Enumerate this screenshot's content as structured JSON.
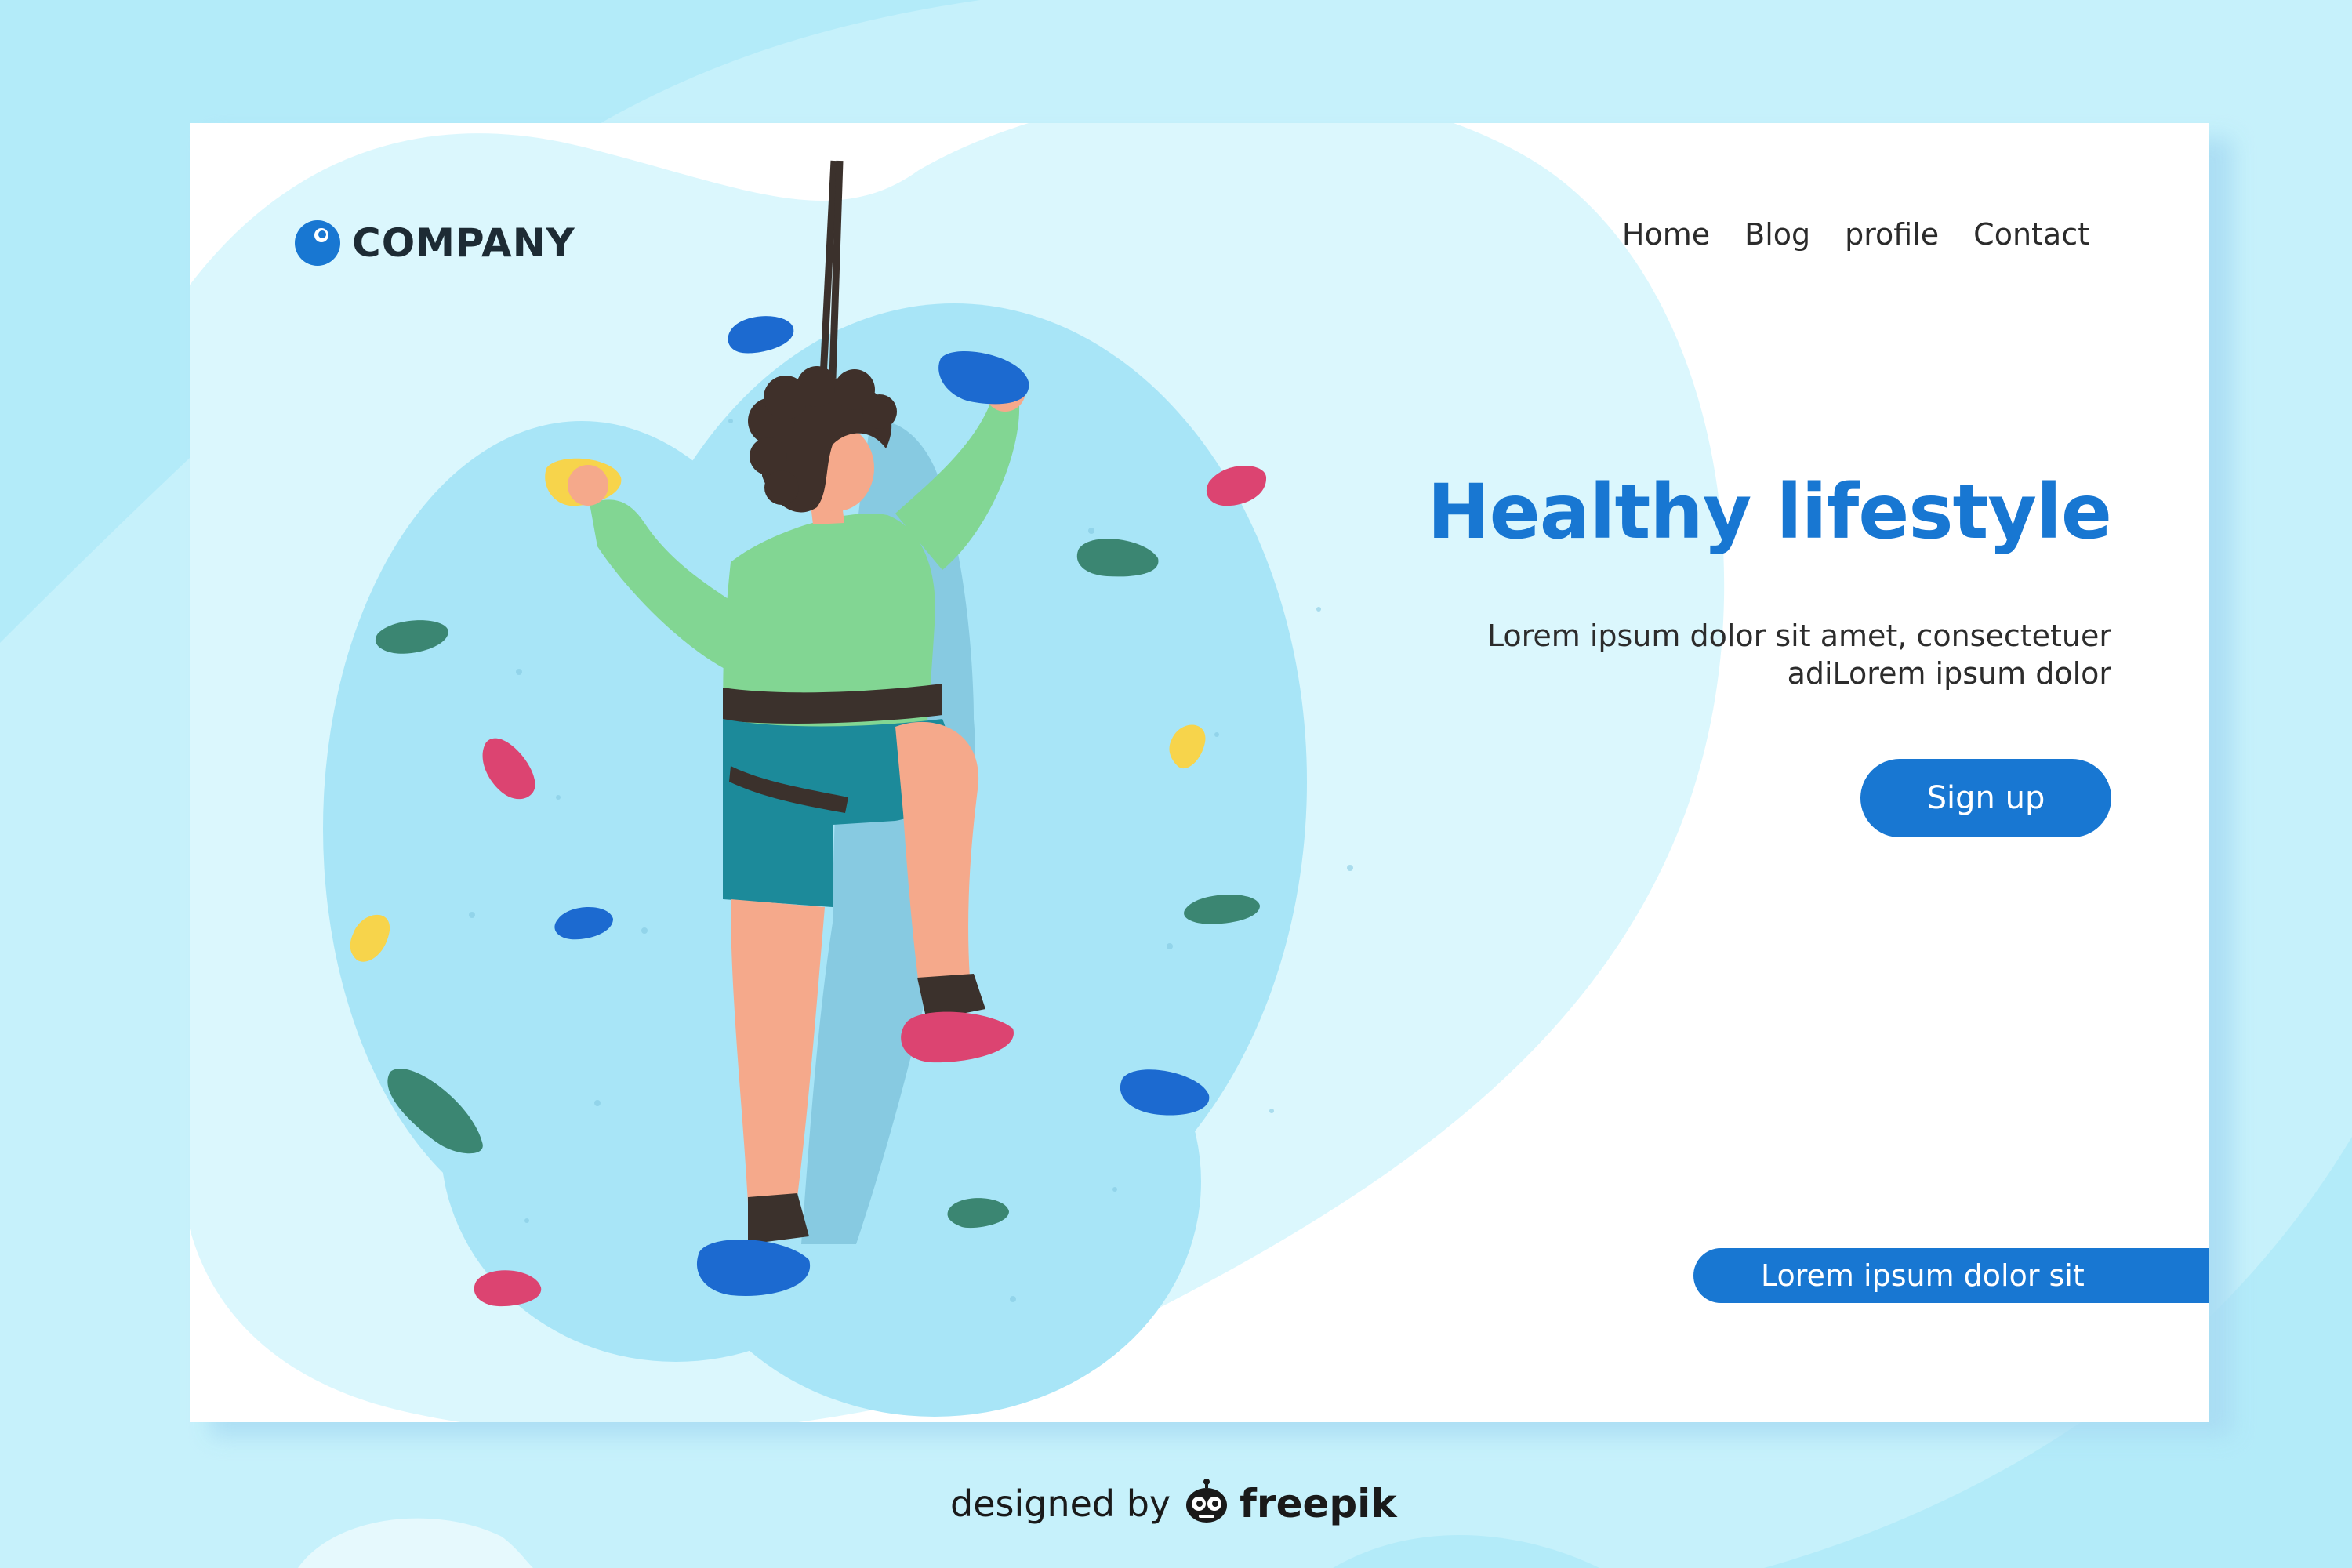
{
  "brand": {
    "name": "COMPANY",
    "icon": "circle-logo-icon"
  },
  "nav": {
    "items": [
      {
        "label": "Home"
      },
      {
        "label": "Blog"
      },
      {
        "label": "profile"
      },
      {
        "label": "Contact"
      }
    ]
  },
  "hero": {
    "title": "Healthy lifestyle",
    "description_line1": "Lorem ipsum dolor sit amet, consectetuer",
    "description_line2": "adiLorem ipsum dolor",
    "signup_label": "Sign up"
  },
  "banner": {
    "text": "Lorem ipsum dolor sit"
  },
  "credit": {
    "prefix": "designed by",
    "brand": "freepik",
    "icon": "freepik-robot-icon"
  },
  "illustration": {
    "subject": "rock-climber-illustration"
  },
  "colors": {
    "background": "#c6f1fb",
    "accent_blue": "#1877d2",
    "wall_blue": "#a6e4f6",
    "hold_green": "#3b8672",
    "hold_red": "#dc4471",
    "hold_yellow": "#f7d44b",
    "hold_blue": "#1c6ad0",
    "shirt_green": "#82d693",
    "shorts_teal": "#1c8a9a"
  }
}
